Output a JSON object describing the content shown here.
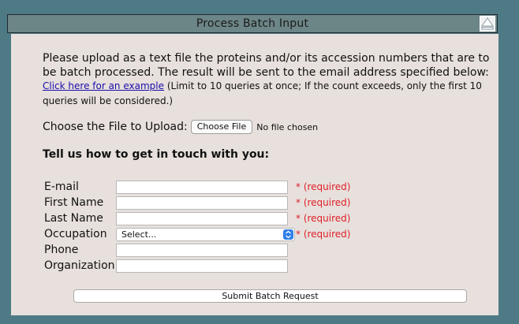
{
  "header": {
    "title": "Process Batch Input",
    "collapse_icon": "eject-up-icon"
  },
  "intro": {
    "text": "Please upload as a text file the proteins and/or its accession numbers that are to be batch processed. The result will be sent to the email address specified below:",
    "example_link": "Click here for an example",
    "limit_note": "(Limit to 10 queries at once; If the count exceeds, only the first 10 queries will be considered.)"
  },
  "upload": {
    "label": "Choose the File to Upload:",
    "button_label": "Choose File",
    "status": "No file chosen"
  },
  "contact": {
    "heading": "Tell us how to get in touch with you:",
    "fields": {
      "email": {
        "label": "E-mail",
        "value": "",
        "required_note": "* (required)"
      },
      "first_name": {
        "label": "First Name",
        "value": "",
        "required_note": "* (required)"
      },
      "last_name": {
        "label": "Last Name",
        "value": "",
        "required_note": "* (required)"
      },
      "occupation": {
        "label": "Occupation",
        "selected": "Select...",
        "required_note": "* (required)"
      },
      "phone": {
        "label": "Phone",
        "value": ""
      },
      "organization": {
        "label": "Organization",
        "value": ""
      }
    }
  },
  "submit": {
    "label": "Submit Batch Request"
  },
  "colors": {
    "background": "#4e7a86",
    "titlebar": "#6c8586",
    "panel": "#e7e0dc",
    "required": "#e0202a",
    "link": "#1a0dab",
    "select_accent": "#2f7fe8"
  }
}
